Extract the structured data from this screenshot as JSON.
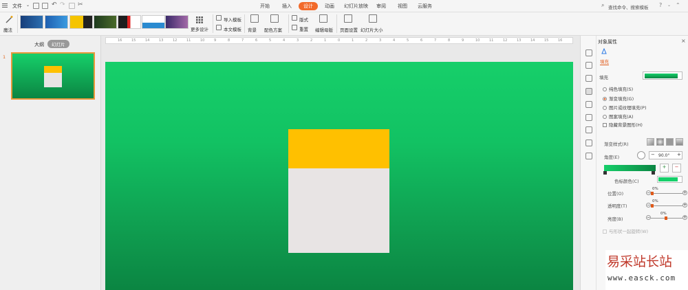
{
  "menubar": {
    "file_label": "文件",
    "tabs": [
      "开始",
      "插入",
      "设计",
      "动画",
      "幻灯片放映",
      "审阅",
      "视图",
      "云服务"
    ],
    "search_label": "查找命令、搜索模板",
    "help": "?"
  },
  "ribbon": {
    "magic_label": "魔法",
    "more_design_label": "更多设计",
    "import_template_label": "导入模板",
    "text_template_label": "本文模板",
    "background_label": "背景",
    "color_scheme_label": "配色方案",
    "layout_label": "版式",
    "reset_label": "重置",
    "edit_master_label": "编辑母版",
    "page_setup_label": "页面设置",
    "slide_size_label": "幻灯片大小"
  },
  "left_panel": {
    "tab_outline": "大纲",
    "tab_slides": "幻灯片",
    "slide_number": "1"
  },
  "ruler": {
    "ticks": [
      "16",
      "15",
      "14",
      "13",
      "12",
      "11",
      "10",
      "9",
      "8",
      "7",
      "6",
      "5",
      "4",
      "3",
      "2",
      "1",
      "0",
      "1",
      "2",
      "3",
      "4",
      "5",
      "6",
      "7",
      "8",
      "9",
      "10",
      "11",
      "12",
      "13",
      "14",
      "15",
      "16"
    ]
  },
  "right_panel": {
    "title": "对象属性",
    "fill_tab": "填充",
    "fill_section": "填充",
    "options": [
      "纯色填充(S)",
      "渐变填充(G)",
      "图片或纹理填充(P)",
      "图案填充(A)"
    ],
    "hide_bg_label": "隐藏背景图形(H)",
    "gradient_style_label": "渐变样式(R)",
    "angle_label": "角度(E)",
    "angle_value": "90.0°",
    "stop_color_label": "色标颜色(C)",
    "position_label": "位置(O)",
    "position_value": "0%",
    "transparency_label": "透明度(T)",
    "transparency_value": "0%",
    "brightness_label": "亮度(B)",
    "brightness_value": "0%",
    "rotate_with_shape_label": "与形状一起旋转(W)"
  },
  "watermark": {
    "line1": "易采站长站",
    "line2": "www.easck.com"
  },
  "colors": {
    "accent": "#f26a2a",
    "green": "#16cf6a",
    "yellow": "#ffc000",
    "card": "#e8e4e4"
  }
}
